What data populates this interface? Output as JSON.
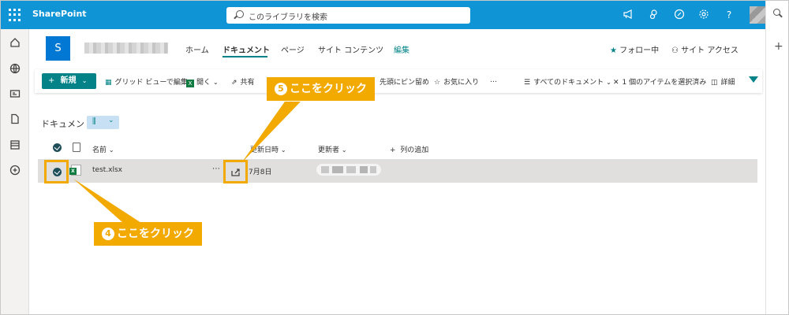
{
  "app": {
    "brand": "SharePoint"
  },
  "search": {
    "placeholder": "このライブラリを検索"
  },
  "site": {
    "logo_letter": "S",
    "nav": [
      "ホーム",
      "ドキュメント",
      "ページ",
      "サイト コンテンツ",
      "編集"
    ],
    "follow_label": "フォロー中",
    "access_label": "サイト アクセス"
  },
  "commands": {
    "new_label": "新規",
    "grid_edit": "グリッド ビューで編集",
    "open": "開く",
    "share": "共有",
    "pin_top": "先頭にピン留め",
    "favorite": "お気に入り",
    "more": "…",
    "all_docs": "すべてのドキュメント",
    "selected": "1 個のアイテムを選択済み",
    "details": "詳細"
  },
  "library": {
    "title": "ドキュメント",
    "columns": {
      "name": "名前",
      "modified": "更新日時",
      "modified_by": "更新者",
      "add_column": "列の追加"
    },
    "rows": [
      {
        "name": "test.xlsx",
        "modified": "7月8日"
      }
    ]
  },
  "callouts": {
    "step4": {
      "num": "4",
      "text": "ここをクリック"
    },
    "step5": {
      "num": "5",
      "text": "ここをクリック"
    }
  },
  "colors": {
    "suite": "#0f94d6",
    "accent": "#038387",
    "callout": "#f2a900"
  }
}
